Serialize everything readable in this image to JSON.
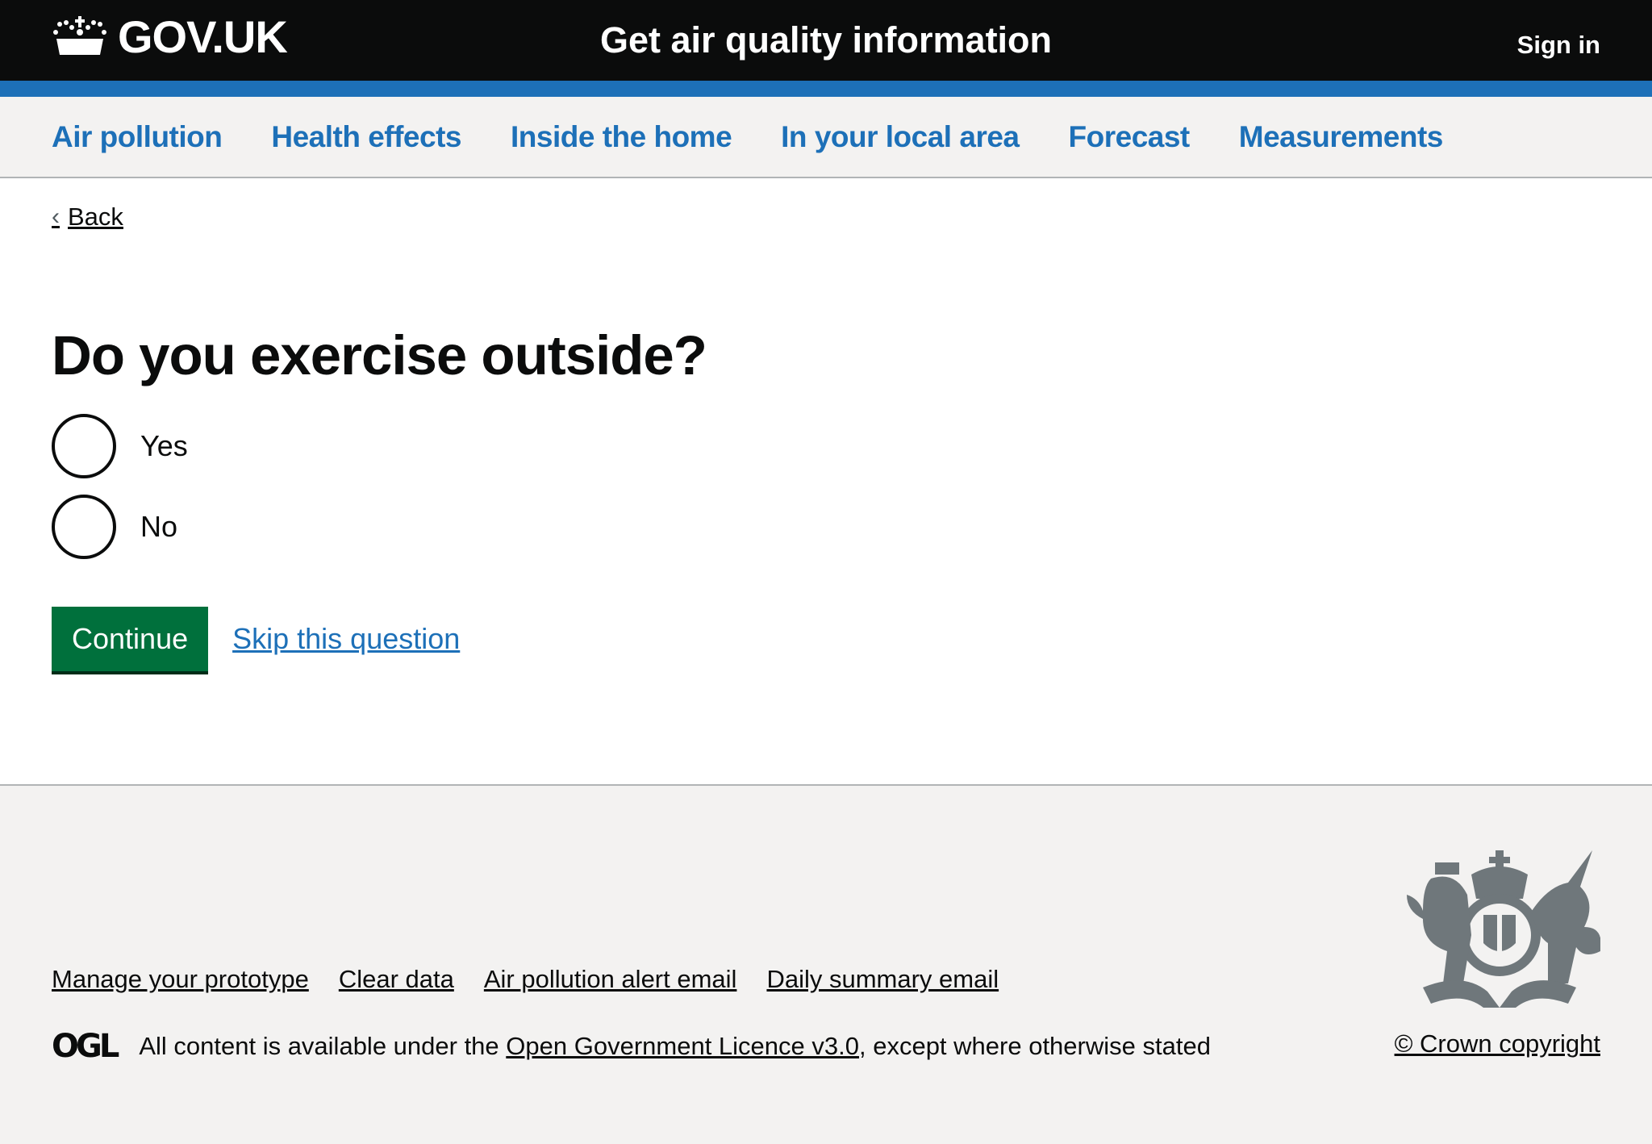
{
  "header": {
    "logo_text": "GOV.UK",
    "service_name": "Get air quality information",
    "sign_in": "Sign in"
  },
  "nav": {
    "items": [
      {
        "label": "Air pollution"
      },
      {
        "label": "Health effects"
      },
      {
        "label": "Inside the home"
      },
      {
        "label": "In your local area"
      },
      {
        "label": "Forecast"
      },
      {
        "label": "Measurements"
      }
    ]
  },
  "main": {
    "back_label": "Back",
    "question": "Do you exercise outside?",
    "options": [
      {
        "label": "Yes",
        "checked": false
      },
      {
        "label": "No",
        "checked": false
      }
    ],
    "continue_label": "Continue",
    "skip_label": "Skip this question"
  },
  "footer": {
    "links": [
      {
        "label": "Manage your prototype"
      },
      {
        "label": "Clear data"
      },
      {
        "label": "Air pollution alert email"
      },
      {
        "label": "Daily summary email"
      }
    ],
    "ogl_logo": "OGL",
    "licence_prefix": "All content is available under the ",
    "licence_link": "Open Government Licence v3.0",
    "licence_suffix": ", except where otherwise stated",
    "copyright": "© Crown copyright"
  },
  "colors": {
    "header_bg": "#0b0c0c",
    "brand_blue": "#1d70b8",
    "button_green": "#00703c",
    "footer_bg": "#f3f2f1"
  }
}
